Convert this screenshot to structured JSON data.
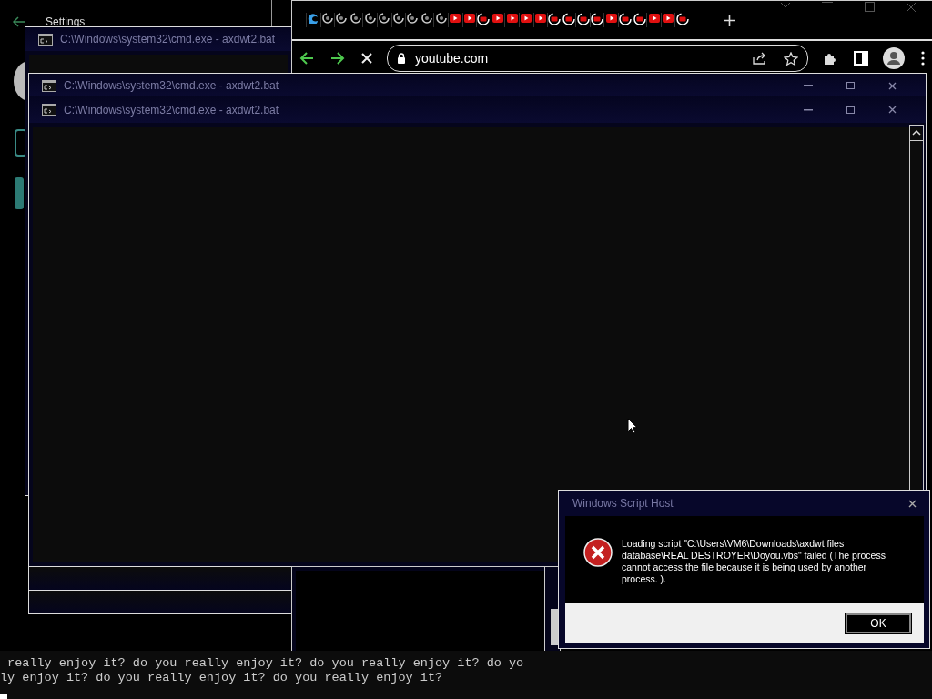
{
  "settings_window": {
    "title": "Settings"
  },
  "cmd_windows": [
    {
      "title": "C:\\Windows\\system32\\cmd.exe - axdwt2.bat",
      "controls": false
    },
    {
      "title": "C:\\Windows\\system32\\cmd.exe - axdwt2.bat",
      "controls": true
    },
    {
      "title": "C:\\Windows\\system32\\cmd.exe - axdwt2.bat",
      "controls": true
    }
  ],
  "browser": {
    "tabs": [
      {
        "kind": "edge"
      },
      {
        "kind": "spinner"
      },
      {
        "kind": "spinner"
      },
      {
        "kind": "spinner"
      },
      {
        "kind": "spinner"
      },
      {
        "kind": "spinner"
      },
      {
        "kind": "spinner"
      },
      {
        "kind": "spinner"
      },
      {
        "kind": "spinner"
      },
      {
        "kind": "spinner"
      },
      {
        "kind": "youtube"
      },
      {
        "kind": "youtube"
      },
      {
        "kind": "youtube-loading"
      },
      {
        "kind": "youtube"
      },
      {
        "kind": "youtube"
      },
      {
        "kind": "youtube"
      },
      {
        "kind": "youtube"
      },
      {
        "kind": "youtube-loading"
      },
      {
        "kind": "youtube-loading"
      },
      {
        "kind": "youtube-loading"
      },
      {
        "kind": "youtube-loading"
      },
      {
        "kind": "youtube"
      },
      {
        "kind": "youtube-loading"
      },
      {
        "kind": "youtube-loading"
      },
      {
        "kind": "youtube"
      },
      {
        "kind": "youtube"
      },
      {
        "kind": "youtube-loading"
      }
    ],
    "address": "youtube.com",
    "loading": true
  },
  "dialog": {
    "title": "Windows Script Host",
    "message": "Loading script \"C:\\Users\\VM6\\Downloads\\axdwt files database\\REAL DESTROYER\\Doyou.vbs\" failed (The process cannot access the file because it is being used by another process. ).",
    "button": "OK"
  },
  "console": {
    "lines": [
      " really enjoy it? do you really enjoy it? do you really enjoy it? do yo",
      "ly enjoy it? do you really enjoy it? do you really enjoy it?"
    ]
  }
}
